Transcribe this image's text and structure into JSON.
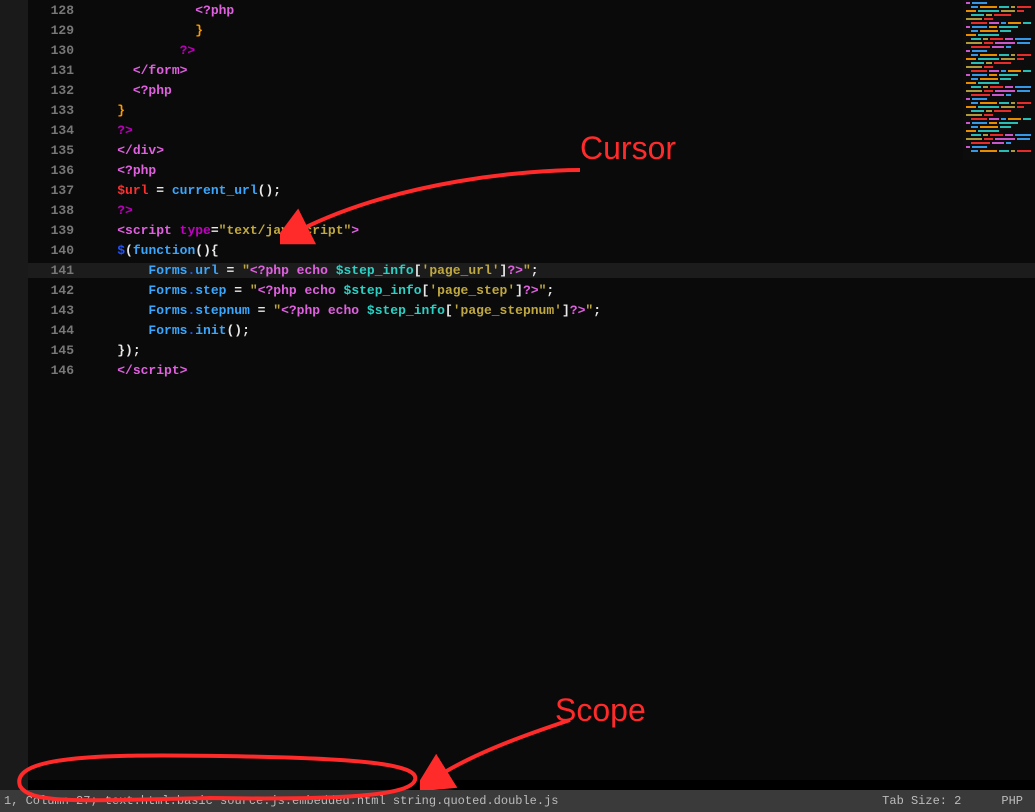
{
  "lines": [
    {
      "n": 128,
      "indent": 14,
      "tokens": [
        {
          "t": "<?php",
          "c": "c-tag"
        }
      ]
    },
    {
      "n": 129,
      "indent": 14,
      "tokens": [
        {
          "t": "}",
          "c": "c-brace"
        }
      ]
    },
    {
      "n": 130,
      "indent": 12,
      "tokens": [
        {
          "t": "?>",
          "c": "c-close"
        }
      ]
    },
    {
      "n": 131,
      "indent": 6,
      "tokens": [
        {
          "t": "</form>",
          "c": "c-tag"
        }
      ]
    },
    {
      "n": 132,
      "indent": 6,
      "tokens": [
        {
          "t": "<?php",
          "c": "c-tag"
        }
      ]
    },
    {
      "n": 133,
      "indent": 4,
      "tokens": [
        {
          "t": "}",
          "c": "c-brace"
        }
      ]
    },
    {
      "n": 134,
      "indent": 4,
      "tokens": [
        {
          "t": "?>",
          "c": "c-close"
        }
      ]
    },
    {
      "n": 135,
      "indent": 4,
      "tokens": [
        {
          "t": "</div>",
          "c": "c-tag"
        }
      ]
    },
    {
      "n": 136,
      "indent": 4,
      "tokens": [
        {
          "t": "<?php",
          "c": "c-tag"
        }
      ]
    },
    {
      "n": 137,
      "indent": 4,
      "tokens": [
        {
          "t": "$url",
          "c": "c-red"
        },
        {
          "t": " = ",
          "c": "c-white"
        },
        {
          "t": "current_url",
          "c": "c-blue"
        },
        {
          "t": "();",
          "c": "c-white"
        }
      ]
    },
    {
      "n": 138,
      "indent": 4,
      "tokens": [
        {
          "t": "?>",
          "c": "c-close"
        }
      ]
    },
    {
      "n": 139,
      "indent": 4,
      "tokens": [
        {
          "t": "<script ",
          "c": "c-tag"
        },
        {
          "t": "type",
          "c": "c-keyword"
        },
        {
          "t": "=",
          "c": "c-white"
        },
        {
          "t": "\"text/javascript\"",
          "c": "c-str"
        },
        {
          "t": ">",
          "c": "c-tag"
        }
      ]
    },
    {
      "n": 140,
      "indent": 4,
      "tokens": [
        {
          "t": "$",
          "c": "c-deepblue"
        },
        {
          "t": "(",
          "c": "c-white"
        },
        {
          "t": "function",
          "c": "c-blue"
        },
        {
          "t": "(){",
          "c": "c-white"
        }
      ]
    },
    {
      "n": 141,
      "indent": 8,
      "current": true,
      "tokens": [
        {
          "t": "Forms",
          "c": "c-blue"
        },
        {
          "t": ".",
          "c": "c-deepblue"
        },
        {
          "t": "url",
          "c": "c-blue"
        },
        {
          "t": " = ",
          "c": "c-white"
        },
        {
          "t": "\"",
          "c": "c-str"
        },
        {
          "t": "<?php echo ",
          "c": "c-tag"
        },
        {
          "t": "$step_info",
          "c": "c-teal"
        },
        {
          "t": "[",
          "c": "c-white"
        },
        {
          "t": "'page_url'",
          "c": "c-str"
        },
        {
          "t": "]",
          "c": "c-white"
        },
        {
          "t": "?>",
          "c": "c-tag"
        },
        {
          "t": "\"",
          "c": "c-str"
        },
        {
          "t": ";",
          "c": "c-white"
        }
      ]
    },
    {
      "n": 142,
      "indent": 8,
      "tokens": [
        {
          "t": "Forms",
          "c": "c-blue"
        },
        {
          "t": ".",
          "c": "c-deepblue"
        },
        {
          "t": "step",
          "c": "c-blue"
        },
        {
          "t": " = ",
          "c": "c-white"
        },
        {
          "t": "\"",
          "c": "c-str"
        },
        {
          "t": "<?php echo ",
          "c": "c-tag"
        },
        {
          "t": "$step_info",
          "c": "c-teal"
        },
        {
          "t": "[",
          "c": "c-white"
        },
        {
          "t": "'page_step'",
          "c": "c-str"
        },
        {
          "t": "]",
          "c": "c-white"
        },
        {
          "t": "?>",
          "c": "c-tag"
        },
        {
          "t": "\"",
          "c": "c-str"
        },
        {
          "t": ";",
          "c": "c-white"
        }
      ]
    },
    {
      "n": 143,
      "indent": 8,
      "tokens": [
        {
          "t": "Forms",
          "c": "c-blue"
        },
        {
          "t": ".",
          "c": "c-deepblue"
        },
        {
          "t": "stepnum",
          "c": "c-blue"
        },
        {
          "t": " = ",
          "c": "c-white"
        },
        {
          "t": "\"",
          "c": "c-str"
        },
        {
          "t": "<?php echo ",
          "c": "c-tag"
        },
        {
          "t": "$step_info",
          "c": "c-teal"
        },
        {
          "t": "[",
          "c": "c-white"
        },
        {
          "t": "'page_stepnum'",
          "c": "c-str"
        },
        {
          "t": "]",
          "c": "c-white"
        },
        {
          "t": "?>",
          "c": "c-tag"
        },
        {
          "t": "\"",
          "c": "c-str"
        },
        {
          "t": ";",
          "c": "c-white"
        }
      ]
    },
    {
      "n": 144,
      "indent": 8,
      "tokens": [
        {
          "t": "Forms",
          "c": "c-blue"
        },
        {
          "t": ".",
          "c": "c-deepblue"
        },
        {
          "t": "init",
          "c": "c-blue"
        },
        {
          "t": "();",
          "c": "c-white"
        }
      ]
    },
    {
      "n": 145,
      "indent": 4,
      "tokens": [
        {
          "t": "});",
          "c": "c-white"
        }
      ]
    },
    {
      "n": 146,
      "indent": 4,
      "tokens": [
        {
          "t": "</script>",
          "c": "c-tag"
        }
      ]
    }
  ],
  "status": {
    "left": "1, Column 27; text.html.basic source.js.embedded.html string.quoted.double.js",
    "tab_size": "Tab Size: 2",
    "lang": "PHP"
  },
  "annotations": {
    "cursor_label": "Cursor",
    "scope_label": "Scope"
  },
  "colors": {
    "annotation": "#ff2a2a"
  }
}
